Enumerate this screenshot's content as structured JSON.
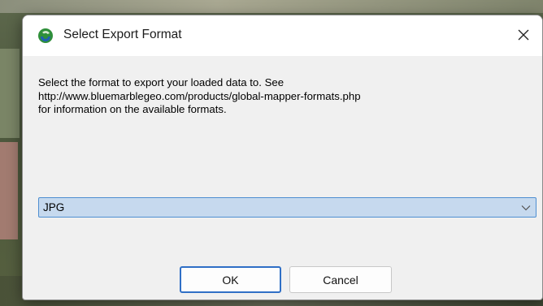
{
  "dialog": {
    "title": "Select Export Format",
    "app_icon": "global-mapper-app-icon",
    "close_icon": "close-icon",
    "message_lines": [
      "Select the format to export your loaded data to. See",
      "http://www.bluemarblegeo.com/products/global-mapper-formats.php",
      "for information on the available formats."
    ],
    "format_select": {
      "selected_value": "JPG",
      "arrow_icon": "chevron-down-icon"
    },
    "buttons": {
      "ok_label": "OK",
      "cancel_label": "Cancel"
    }
  },
  "colors": {
    "dialog_background": "#f0f0f0",
    "title_bar": "#ffffff",
    "select_highlight": "#c6d9ee",
    "select_border": "#4f8fd1",
    "default_button_border": "#2f6fc6"
  }
}
